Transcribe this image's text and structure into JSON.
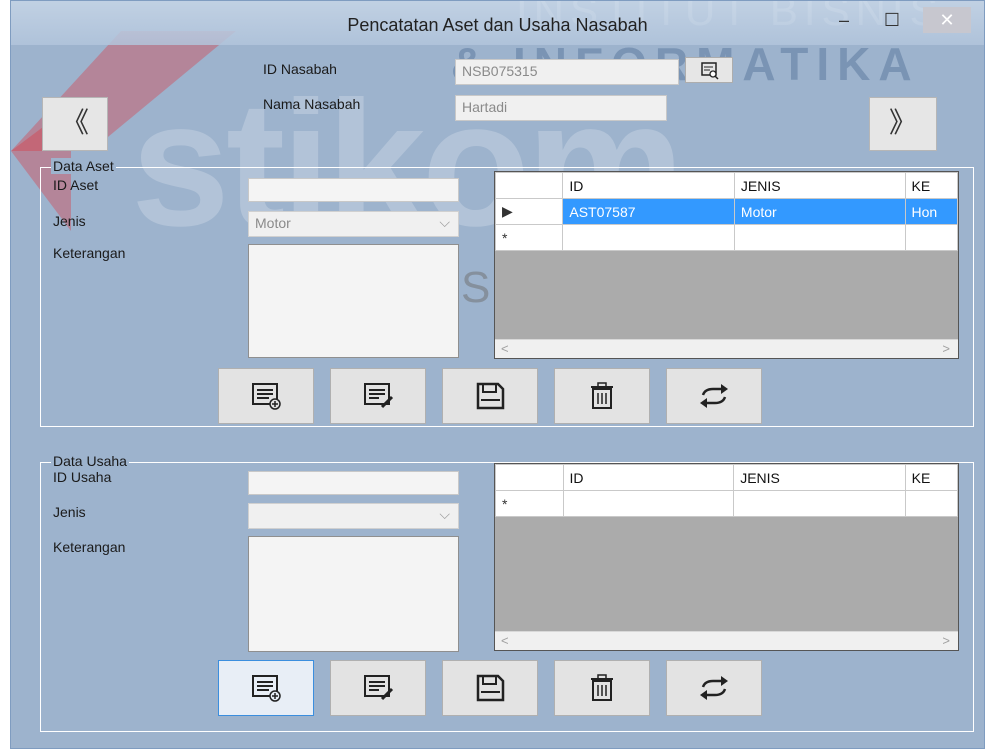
{
  "window": {
    "title": "Pencatatan Aset dan Usaha Nasabah",
    "min_glyph": "–",
    "max_glyph": "☐",
    "close_glyph": "✕"
  },
  "watermark": {
    "brand": "stikom",
    "line1": "INSTITUT BISNIS",
    "line2": "& INFORMATIKA",
    "line3": "SURABAYA"
  },
  "nasabah": {
    "id_label": "ID Nasabah",
    "id_value": "NSB075315",
    "name_label": "Nama Nasabah",
    "name_value": "Hartadi"
  },
  "nav": {
    "prev": "《",
    "next": "》"
  },
  "aset": {
    "group_title": "Data Aset",
    "id_label": "ID Aset",
    "id_value": "",
    "jenis_label": "Jenis",
    "jenis_value": "Motor",
    "keterangan_label": "Keterangan",
    "grid": {
      "columns": [
        "ID",
        "JENIS",
        "KE"
      ],
      "rows": [
        {
          "marker": "▶",
          "cells": [
            "AST07587",
            "Motor",
            "Hon"
          ]
        }
      ],
      "new_row_marker": "*"
    }
  },
  "usaha": {
    "group_title": "Data Usaha",
    "id_label": "ID Usaha",
    "id_value": "",
    "jenis_label": "Jenis",
    "jenis_value": "",
    "keterangan_label": "Keterangan",
    "grid": {
      "columns": [
        "ID",
        "JENIS",
        "KE"
      ],
      "rows": [],
      "new_row_marker": "*"
    }
  },
  "scroll": {
    "left": "<",
    "right": ">"
  },
  "colors": {
    "accent": "#3399ff",
    "window_bg": "#9db3cd",
    "watermark_red": "#e0303a"
  }
}
